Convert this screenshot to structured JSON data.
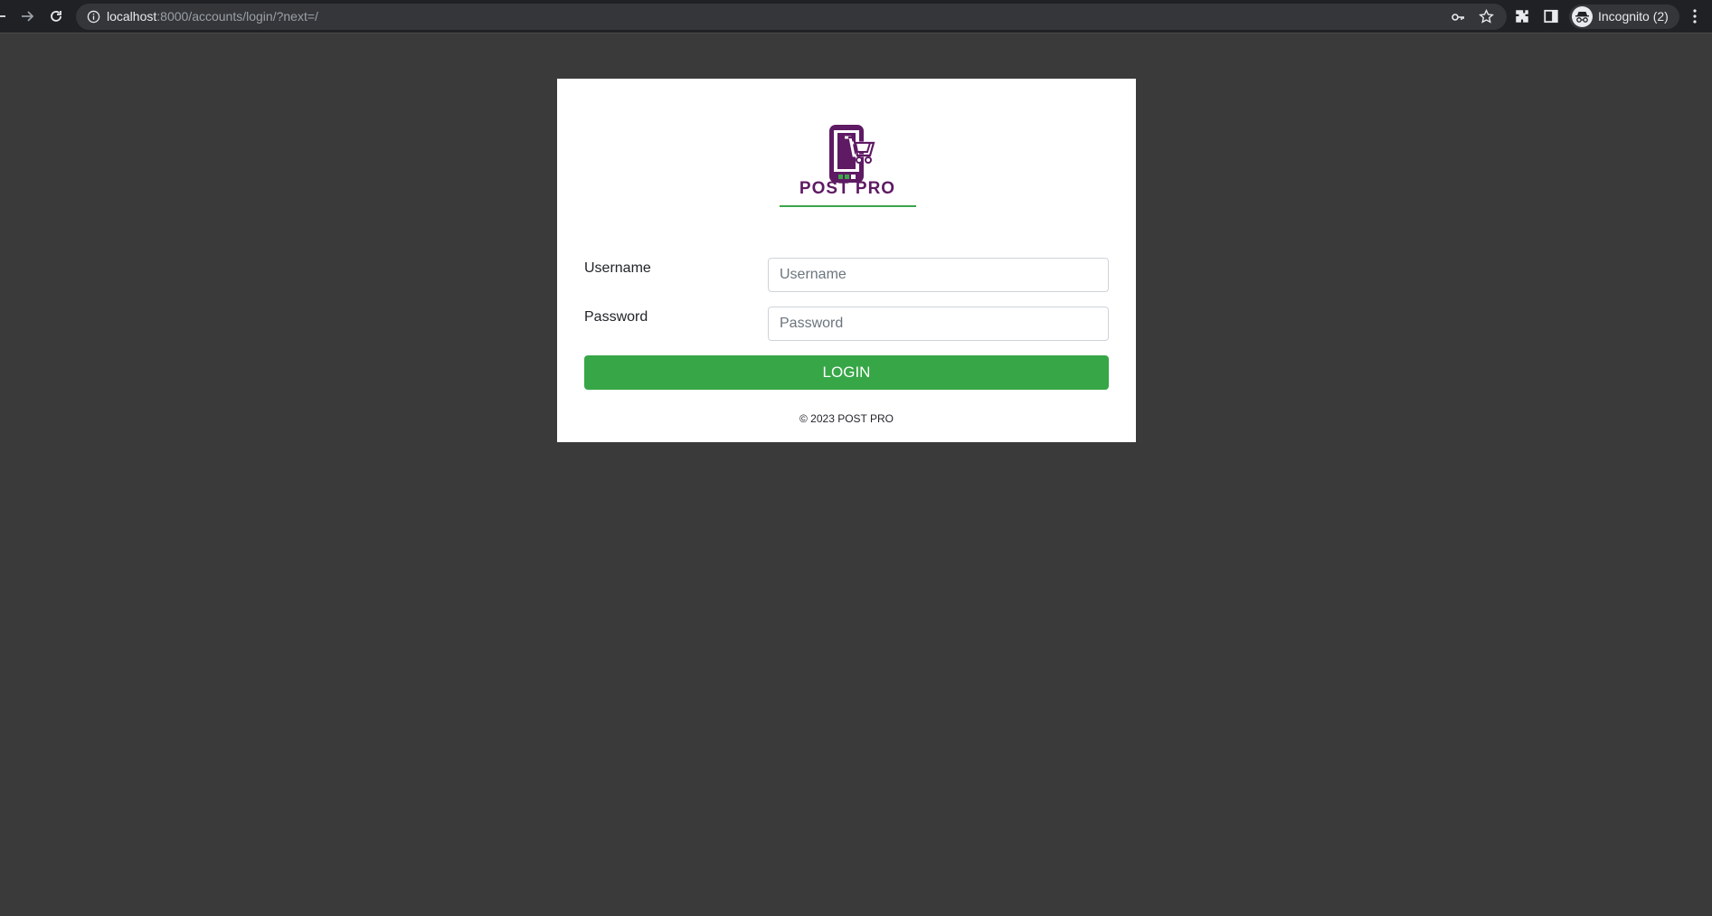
{
  "browser": {
    "url_host": "localhost",
    "url_rest": ":8000/accounts/login/?next=/",
    "profile_label": "Incognito (2)"
  },
  "logo": {
    "text": "POST PRO",
    "primary_color": "#5e1a63",
    "accent_color": "#3aa64a"
  },
  "form": {
    "username_label": "Username",
    "username_placeholder": "Username",
    "username_value": "",
    "password_label": "Password",
    "password_placeholder": "Password",
    "password_value": "",
    "submit_label": "LOGIN"
  },
  "footer": {
    "text": "© 2023 POST PRO"
  },
  "colors": {
    "page_background": "#3a3a3a",
    "button": "#37a647"
  }
}
